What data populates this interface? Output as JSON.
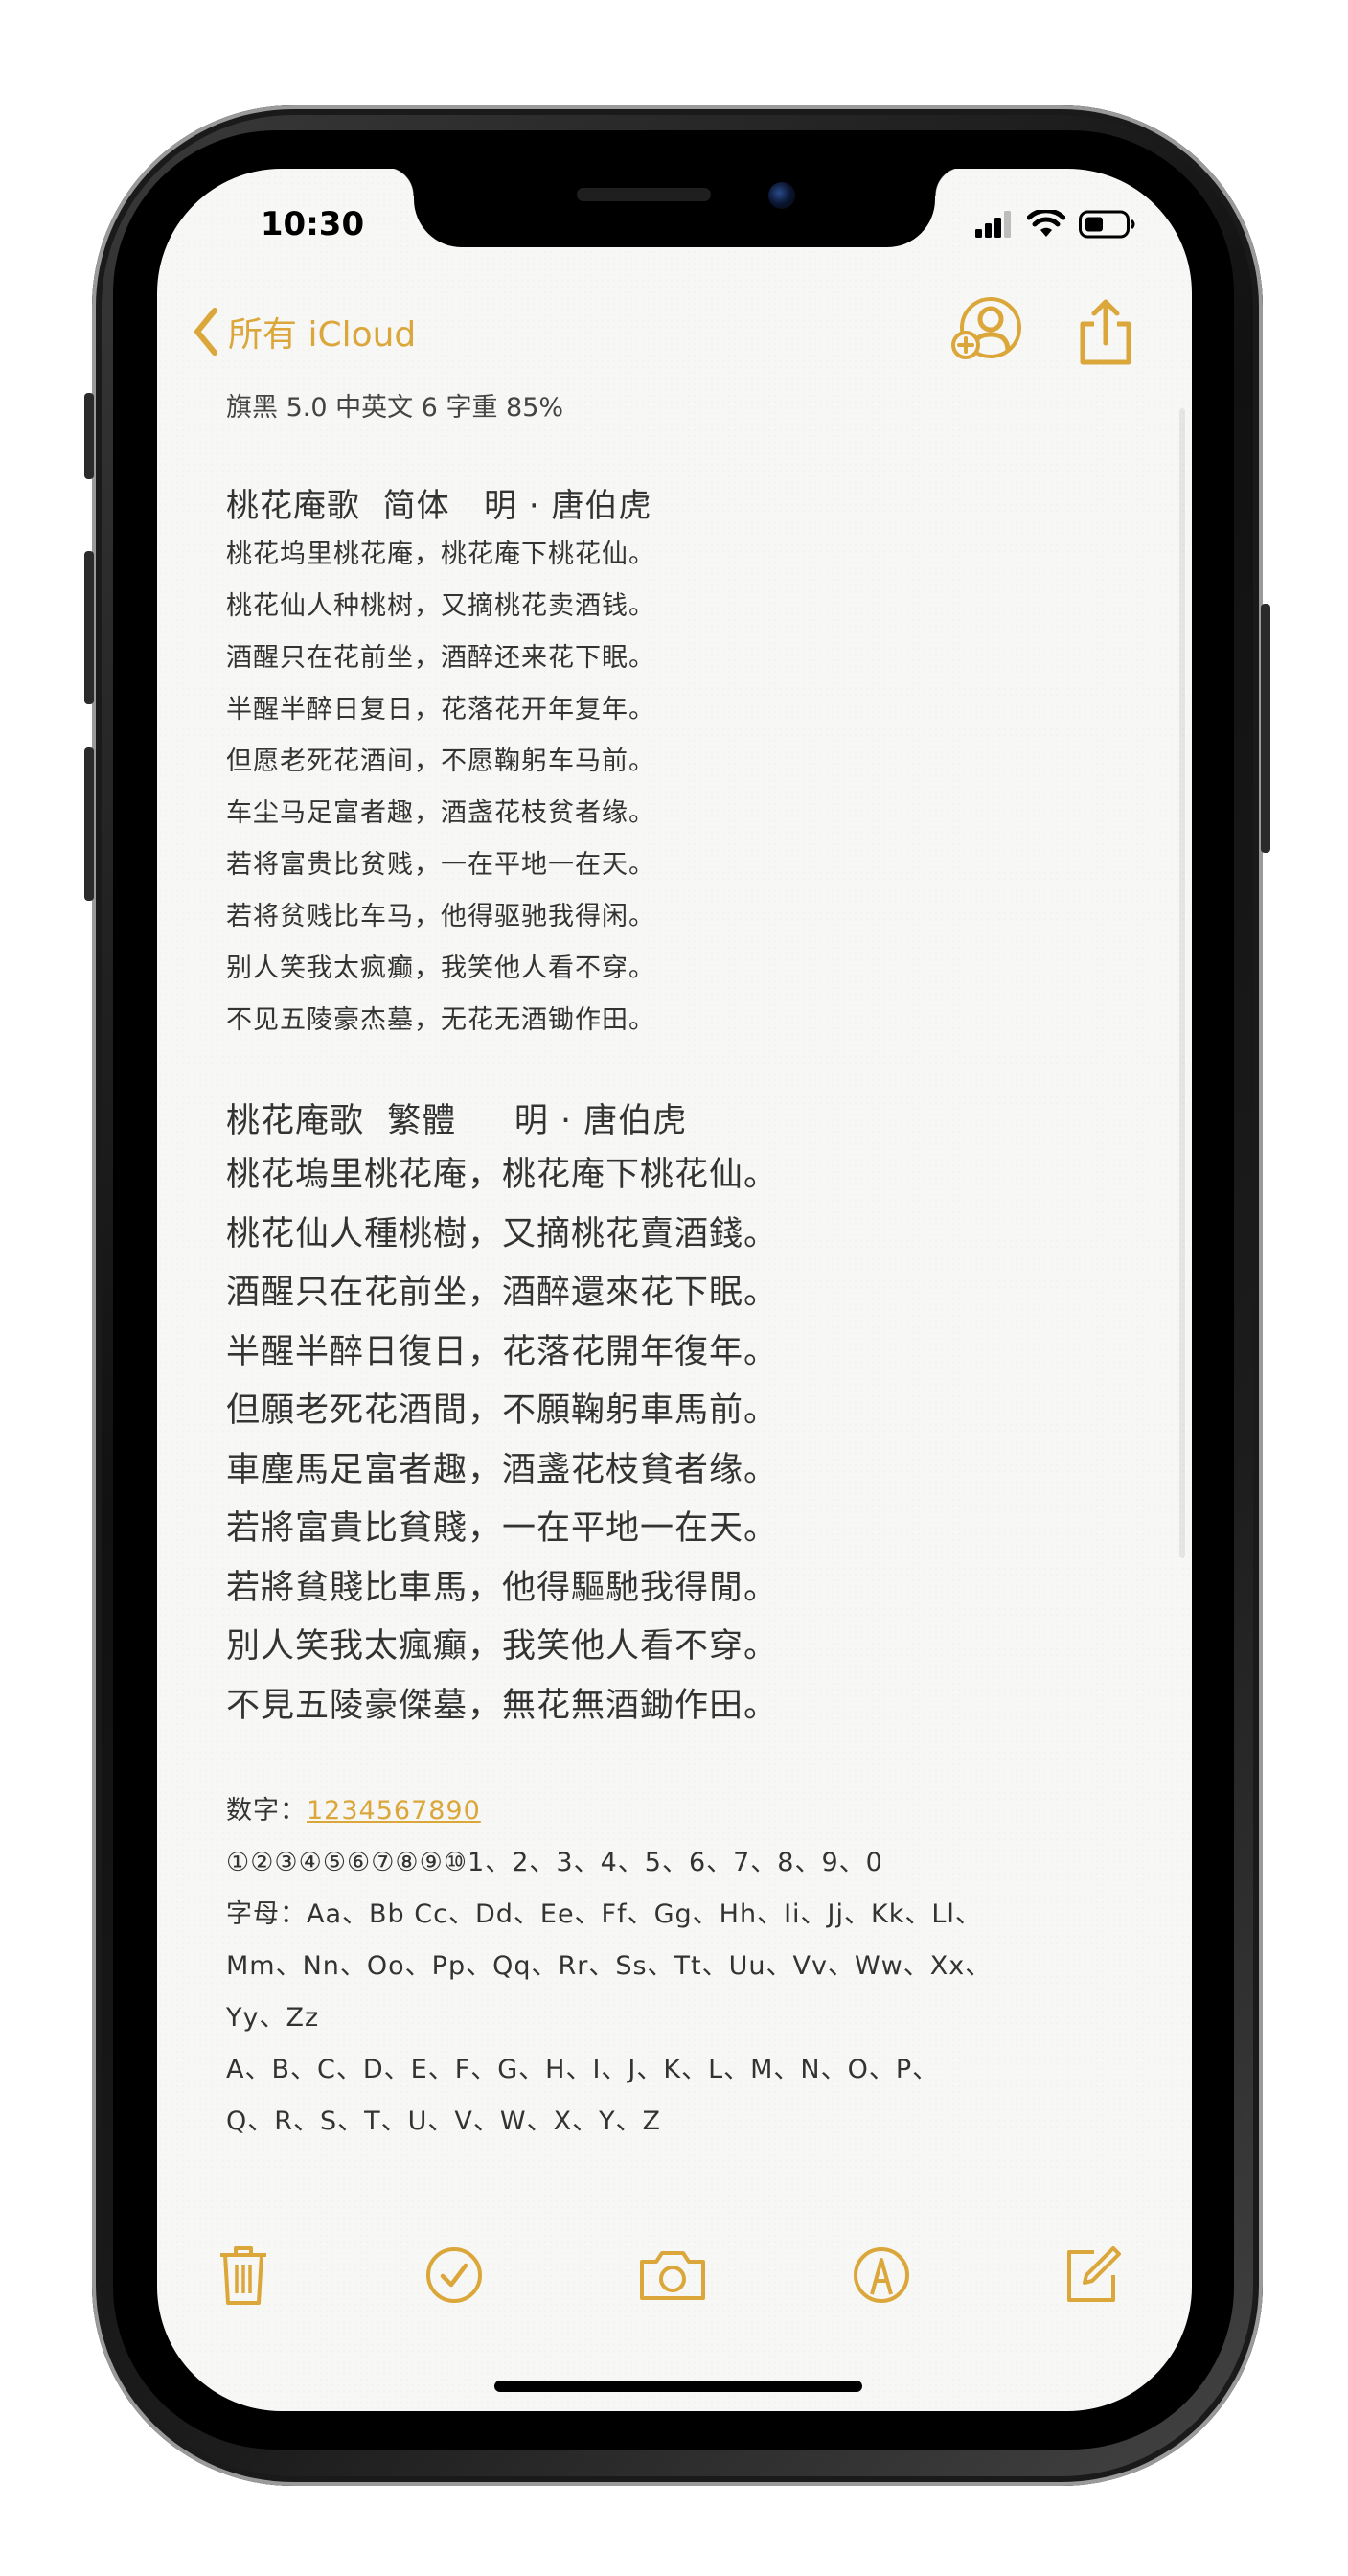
{
  "status_bar": {
    "time": "10:30"
  },
  "nav": {
    "back_label": "所有 iCloud",
    "add_person_icon": "person-add-icon",
    "share_icon": "share-icon"
  },
  "note": {
    "meta": "旗黑 5.0 中英文 6 字重 85%",
    "simplified": {
      "title": "桃花庵歌  简体   明 · 唐伯虎",
      "lines": [
        "桃花坞里桃花庵，桃花庵下桃花仙。",
        "桃花仙人种桃树，又摘桃花卖酒钱。",
        "酒醒只在花前坐，酒醉还来花下眠。",
        "半醒半醉日复日，花落花开年复年。",
        "但愿老死花酒间，不愿鞠躬车马前。",
        "车尘马足富者趣，酒盏花枝贫者缘。",
        "若将富贵比贫贱，一在平地一在天。",
        "若将贫贱比车马，他得驱驰我得闲。",
        "别人笑我太疯癫，我笑他人看不穿。",
        "不见五陵豪杰墓，无花无酒锄作田。"
      ]
    },
    "traditional": {
      "title": "桃花庵歌  繁體     明 · 唐伯虎",
      "lines": [
        "桃花塢里桃花庵，桃花庵下桃花仙。",
        "桃花仙人種桃樹，又摘桃花賣酒錢。",
        "酒醒只在花前坐，酒醉還來花下眠。",
        "半醒半醉日復日，花落花開年復年。",
        "但願老死花酒間，不願鞠躬車馬前。",
        "車塵馬足富者趣，酒盞花枝貧者缘。",
        "若將富貴比貧賤，一在平地一在天。",
        "若將貧賤比車馬，他得驅馳我得閒。",
        "別人笑我太瘋癲，我笑他人看不穿。",
        "不見五陵豪傑墓，無花無酒鋤作田。"
      ]
    },
    "extras": {
      "digits_label": "数字：",
      "digits_value": "1234567890",
      "circled": "①②③④⑤⑥⑦⑧⑨⑩1、2、3、4、5、6、7、8、9、0",
      "letters_lines": [
        "字母：Aa、Bb Cc、Dd、Ee、Ff、Gg、Hh、Ii、Jj、Kk、Ll、",
        "Mm、Nn、Oo、Pp、Qq、Rr、Ss、Tt、Uu、Vv、Ww、Xx、",
        "Yy、Zz",
        "A、B、C、D、E、F、G、H、I、J、K、L、M、N、O、P、",
        "Q、R、S、T、U、V、W、X、Y、Z"
      ]
    }
  },
  "toolbar": {
    "icons": [
      "trash-icon",
      "checklist-icon",
      "camera-icon",
      "markup-icon",
      "compose-icon"
    ]
  },
  "colors": {
    "accent": "#dba63a",
    "paper": "#f7f7f6",
    "text": "#333333"
  }
}
